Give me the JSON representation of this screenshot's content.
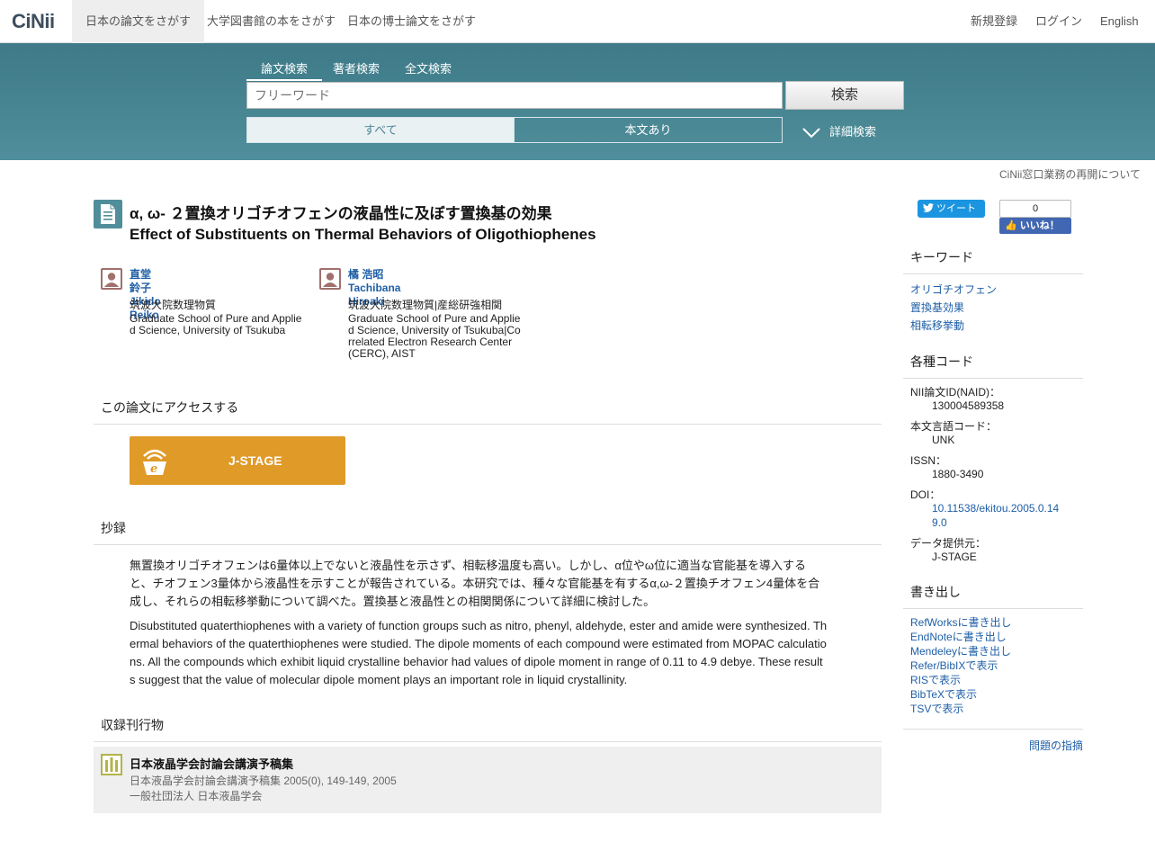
{
  "topnav": {
    "logo": "CiNii",
    "tabs": [
      "日本の論文をさがす",
      "大学図書館の本をさがす",
      "日本の博士論文をさがす"
    ],
    "register": "新規登録",
    "login": "ログイン",
    "language": "English"
  },
  "search": {
    "tabs": [
      "論文検索",
      "著者検索",
      "全文検索"
    ],
    "placeholder": "フリーワード",
    "button": "検索",
    "filter_all": "すべて",
    "filter_body": "本文あり",
    "advanced": "詳細検索"
  },
  "notice": "CiNii窓口業務の再開について",
  "article": {
    "title_ja": "α, ω- ２置換オリゴチオフェンの液晶性に及ぼす置換基の効果",
    "title_en": "Effect of Substituents on Thermal Behaviors of Oligothiophenes",
    "authors": [
      {
        "name_ja": "直堂 鈴子",
        "name_en": "Jikido Reiko",
        "aff_ja": "筑波大院数理物質",
        "aff_en": "Graduate School of Pure and Applied Science, University of Tsukuba"
      },
      {
        "name_ja": "橘 浩昭",
        "name_en": "Tachibana Hiroaki",
        "aff_ja": "筑波大院数理物質|産総研強相関",
        "aff_en": "Graduate School of Pure and Applied Science, University of Tsukuba|Correlated Electron Research Center (CERC), AIST"
      }
    ],
    "access_heading": "この論文にアクセスする",
    "jstage_label": "J-STAGE",
    "abstract_heading": "抄録",
    "abstract_ja": "無置換オリゴチオフェンは6量体以上でないと液晶性を示さず、相転移温度も高い。しかし、α位やω位に適当な官能基を導入すると、チオフェン3量体から液晶性を示すことが報告されている。本研究では、種々な官能基を有するα,ω-２置換チオフェン4量体を合成し、それらの相転移挙動について調べた。置換基と液晶性との相関関係について詳細に検討した。",
    "abstract_en": "Disubstituted quaterthiophenes with a variety of function groups such as nitro, phenyl, aldehyde, ester and amide were synthesized. Thermal behaviors of the quaterthiophenes were studied. The dipole moments of each compound were estimated from MOPAC calculations. All the compounds which exhibit liquid crystalline behavior had values of dipole moment in range of 0.11 to 4.9 debye. These results suggest that the value of molecular dipole moment plays an important role in liquid crystallinity.",
    "journal_heading": "収録刊行物",
    "journal_name": "日本液晶学会討論会講演予稿集",
    "journal_issue": "日本液晶学会討論会講演予稿集 2005(0), 149-149, 2005",
    "journal_publisher": "一般社団法人 日本液晶学会"
  },
  "sidebar": {
    "tweet": "ツイート",
    "like_count": "0",
    "like_label": "いいね！",
    "keywords_heading": "キーワード",
    "keywords": [
      "オリゴチオフェン",
      "置換基効果",
      "相転移挙動"
    ],
    "codes_heading": "各種コード",
    "naid_label": "NII論文ID(NAID)：",
    "naid": "130004589358",
    "lang_label": "本文言語コード：",
    "lang": "UNK",
    "issn_label": "ISSN：",
    "issn": "1880-3490",
    "doi_label": "DOI：",
    "doi": "10.11538/ekitou.2005.0.149.0",
    "provider_label": "データ提供元：",
    "provider": "J-STAGE",
    "export_heading": "書き出し",
    "exports": [
      "RefWorksに書き出し",
      "EndNoteに書き出し",
      "Mendeleyに書き出し",
      "Refer/BibIXで表示",
      "RISで表示",
      "BibTeXで表示",
      "TSVで表示"
    ],
    "report": "問題の指摘"
  }
}
